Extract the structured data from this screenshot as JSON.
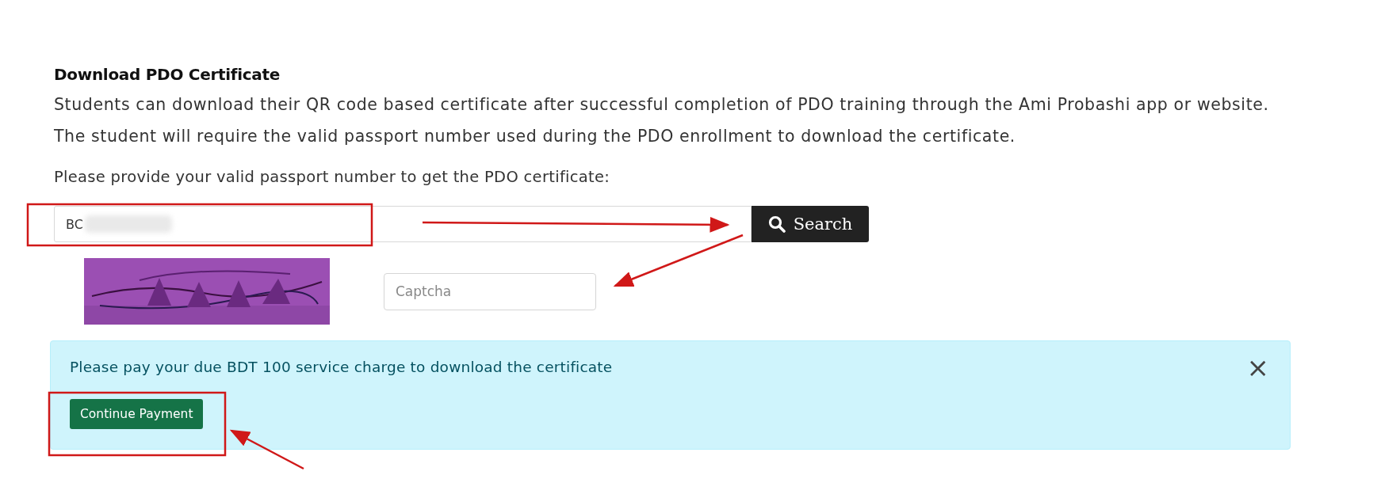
{
  "section": {
    "title": "Download PDO Certificate",
    "description": [
      "Students can download their QR code based certificate after successful completion of PDO training through the Ami Probashi app or website.",
      "The student will require the valid passport number used during the PDO enrollment to download the certificate."
    ],
    "prompt": "Please provide your valid passport number to get the PDO certificate:"
  },
  "search_form": {
    "passport_value": "BC",
    "search_button": "Search",
    "captcha_placeholder": "Captcha"
  },
  "alert": {
    "message": "Please pay your due BDT 100 service charge to download the certificate",
    "close": "×",
    "button": "Continue Payment"
  }
}
